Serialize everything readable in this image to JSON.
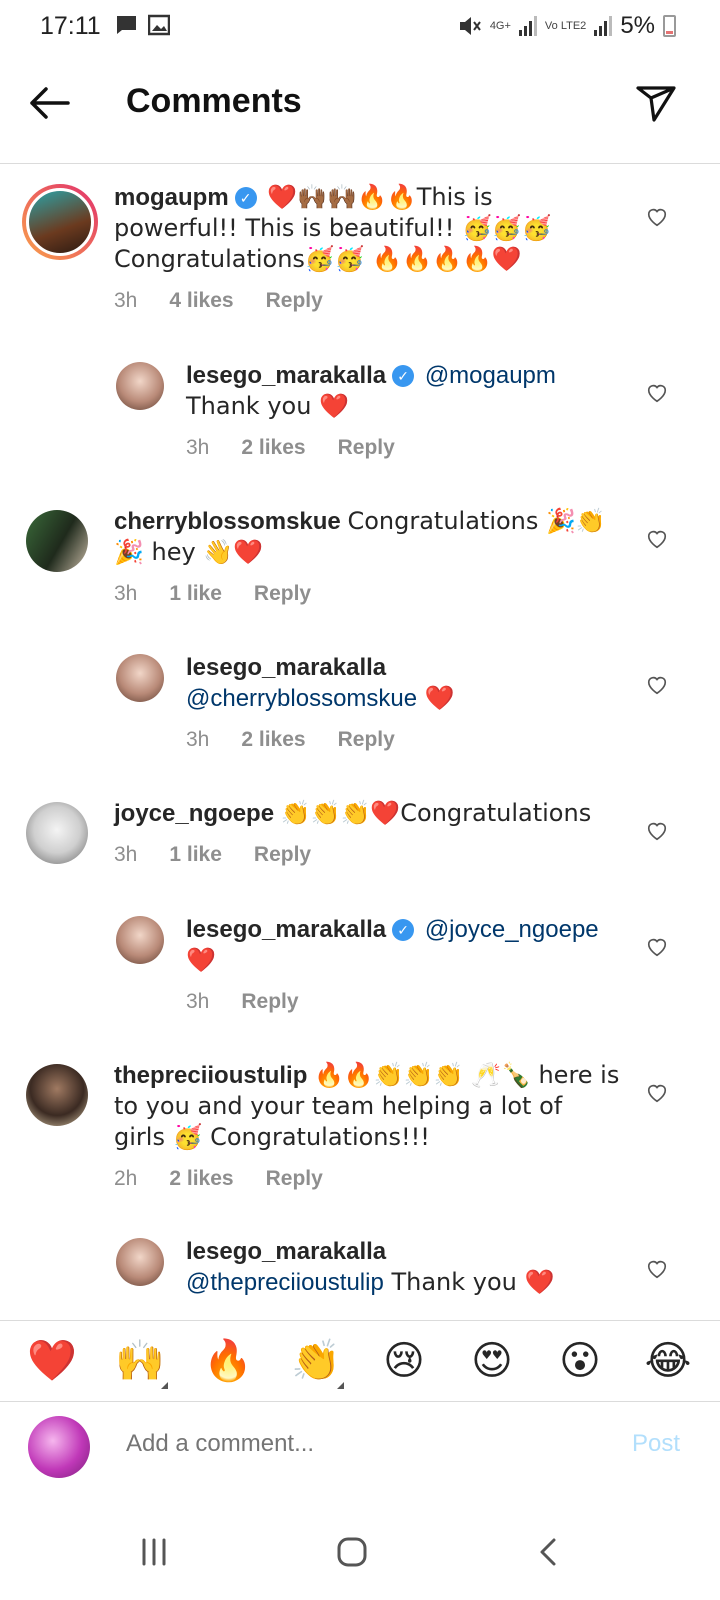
{
  "status_bar": {
    "time": "17:11",
    "network_1": "4G+",
    "network_2": "Vo LTE2",
    "battery": "5%"
  },
  "header": {
    "title": "Comments"
  },
  "comments": [
    {
      "username": "mogaupm",
      "verified": true,
      "text_pre": "❤️🙌🏾🙌🏾🔥🔥This is powerful!! This is beautiful!! 🥳🥳🥳 Congratulations🥳🥳 🔥🔥🔥🔥❤️",
      "mention": "",
      "text_post": "",
      "time": "3h",
      "likes": "4 likes",
      "reply": "Reply"
    },
    {
      "username": "lesego_marakalla",
      "verified": true,
      "text_pre": "",
      "mention": "@mogaupm",
      "text_post": " Thank you ❤️",
      "time": "3h",
      "likes": "2 likes",
      "reply": "Reply"
    },
    {
      "username": "cherryblossomskue",
      "verified": false,
      "text_pre": "Congratulations 🎉👏 🎉 hey 👋❤️",
      "mention": "",
      "text_post": "",
      "time": "3h",
      "likes": "1 like",
      "reply": "Reply"
    },
    {
      "username": "lesego_marakalla",
      "verified": false,
      "text_pre": "",
      "mention": "@cherryblossomskue",
      "text_post": " ❤️",
      "time": "3h",
      "likes": "2 likes",
      "reply": "Reply"
    },
    {
      "username": "joyce_ngoepe",
      "verified": false,
      "text_pre": "👏👏👏❤️Congratulations",
      "mention": "",
      "text_post": "",
      "time": "3h",
      "likes": "1 like",
      "reply": "Reply"
    },
    {
      "username": "lesego_marakalla",
      "verified": true,
      "text_pre": "",
      "mention": "@joyce_ngoepe",
      "text_post": " ❤️",
      "time": "3h",
      "likes": "",
      "reply": "Reply"
    },
    {
      "username": "thepreciioustulip",
      "verified": false,
      "text_pre": "🔥🔥👏👏👏 🥂🍾 here is to you and your team helping a lot of girls 🥳 Congratulations!!!",
      "mention": "",
      "text_post": "",
      "time": "2h",
      "likes": "2 likes",
      "reply": "Reply"
    },
    {
      "username": "lesego_marakalla",
      "verified": false,
      "text_pre": "",
      "mention": "@thepreciioustulip",
      "text_post": " Thank you ❤️",
      "time": "",
      "likes": "",
      "reply": ""
    }
  ],
  "emoji_bar": [
    "❤️",
    "🙌",
    "🔥",
    "👏",
    "😢",
    "😍",
    "😮",
    "😂"
  ],
  "composer": {
    "avatar_icon": "avatar-icon",
    "placeholder": "Add a comment...",
    "post_label": "Post"
  },
  "colors": {
    "link": "#00376b",
    "verified": "#3897f0",
    "post_disabled": "#b2dffc",
    "meta": "#8e8e8e"
  }
}
